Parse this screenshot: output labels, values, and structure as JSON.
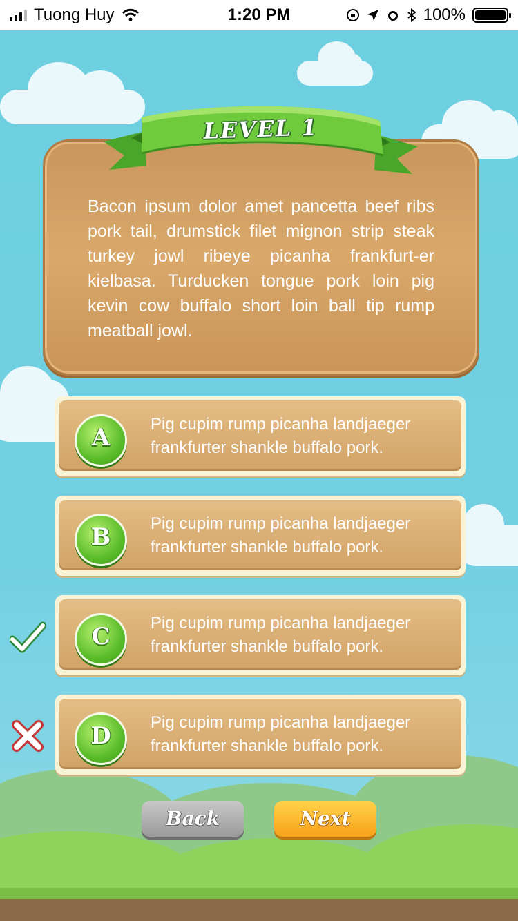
{
  "status_bar": {
    "carrier": "Tuong Huy",
    "time": "1:20 PM",
    "battery": "100%"
  },
  "level": {
    "title": "LEVEL 1",
    "question": "Bacon ipsum dolor amet pancetta beef ribs pork tail, drumstick filet mignon strip steak turkey jowl ribeye picanha frankfurt-er kielbasa. Turducken tongue pork loin pig kevin cow buffalo short loin ball tip rump meatball jowl."
  },
  "answers": [
    {
      "letter": "A",
      "text": "Pig cupim rump picanha landjaeger frankfurter shankle buffalo pork.",
      "result": ""
    },
    {
      "letter": "B",
      "text": "Pig cupim rump picanha landjaeger frankfurter shankle buffalo pork.",
      "result": ""
    },
    {
      "letter": "C",
      "text": "Pig cupim rump picanha landjaeger frankfurter shankle buffalo pork.",
      "result": "correct"
    },
    {
      "letter": "D",
      "text": "Pig cupim rump picanha landjaeger frankfurter shankle buffalo pork.",
      "result": "wrong"
    }
  ],
  "icons": {
    "correct": "checkmark-icon",
    "wrong": "x-mark-icon"
  },
  "nav": {
    "back_label": "Back",
    "next_label": "Next"
  },
  "colors": {
    "sky": "#6dcfe0",
    "panel": "#d9a86a",
    "badge_green": "#5bbd2a",
    "next_orange": "#f7a21a",
    "back_gray": "#9a9a9a"
  }
}
